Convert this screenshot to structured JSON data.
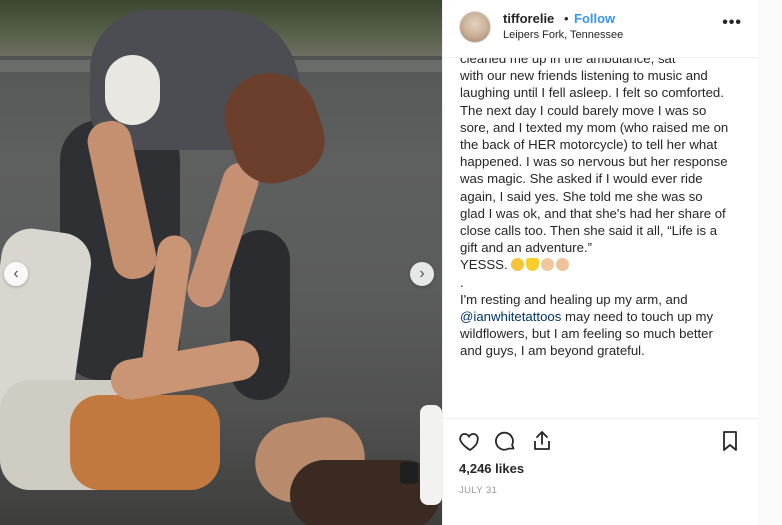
{
  "post": {
    "username": "tifforelie",
    "separator": "•",
    "follow_label": "Follow",
    "location": "Leipers Fork, Tennessee",
    "more_label": "•••",
    "caption": {
      "lead": "cleaned me up in the ambulance, sat",
      "p1": "with our new friends listening to music and laughing until I fell asleep. I felt so comforted. The next day I could barely move I was so sore, and I texted my mom (who raised me on the back of HER motorcycle) to tell her what happened. I was so nervous but her response was magic. She asked if I would ever ride again, I said yes. She told me she was so glad I was ok, and that she's had her share of close calls too. Then she said it all, “Life is a gift and an adventure.”",
      "p2_text": "YESSS.",
      "emojis": [
        "smiling-face-with-heart-eyes",
        "yellow-heart",
        "raising-hands",
        "folded-hands"
      ],
      "p3": ".",
      "p4_before": "I'm resting and healing up my arm, and",
      "p4_link": "@ianwhitetattoos",
      "p4_after": "may need to touch up my wildflowers, but I am feeling so much better and guys, I am beyond grateful."
    },
    "likes": "4,246 likes",
    "date": "JULY 31",
    "carousel": {
      "prev_icon": "‹",
      "next_icon": "›"
    }
  },
  "icons": {
    "heart": "heart-icon",
    "comment": "comment-icon",
    "share": "share-icon",
    "save": "bookmark-icon"
  },
  "colors": {
    "follow": "#3897f0",
    "text": "#262626",
    "muted": "#999999",
    "link": "#003569"
  }
}
